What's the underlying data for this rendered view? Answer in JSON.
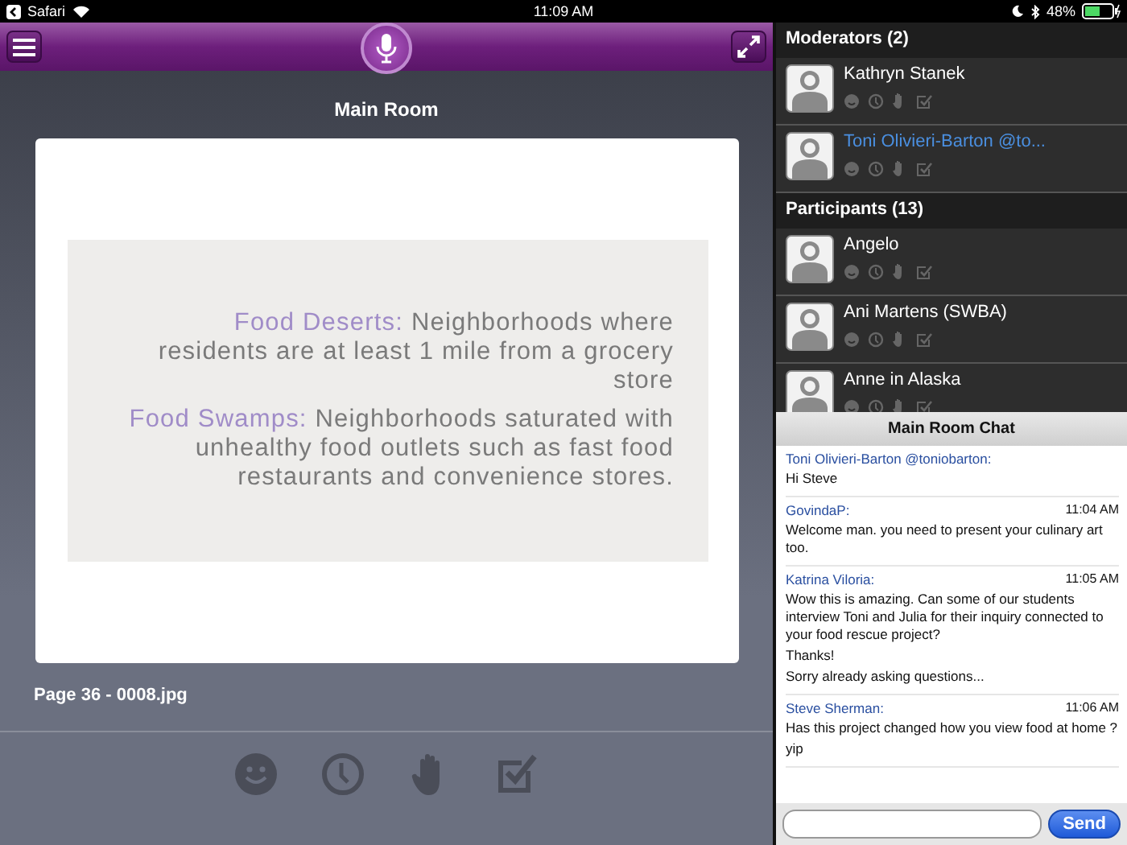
{
  "status_bar": {
    "back_app": "Safari",
    "time": "11:09 AM",
    "battery": "48%"
  },
  "room": {
    "title": "Main Room",
    "page_label": "Page 36 - 0008.jpg"
  },
  "slide": {
    "paragraphs": [
      {
        "term": "Food Deserts:",
        "text": "Neighborhoods where residents are at least 1 mile from a grocery store"
      },
      {
        "term": "Food Swamps:",
        "text": "Neighborhoods saturated with unhealthy food outlets such as fast food restaurants and convenience stores."
      }
    ]
  },
  "groups": [
    {
      "title": "Moderators (2)",
      "members": [
        {
          "name": "Kathryn Stanek",
          "color": "#ffffff"
        },
        {
          "name": "Toni Olivieri-Barton @to...",
          "color": "#4a8fe0"
        }
      ]
    },
    {
      "title": "Participants (13)",
      "members": [
        {
          "name": "Angelo",
          "color": "#ffffff"
        },
        {
          "name": "Ani Martens (SWBA)",
          "color": "#ffffff"
        },
        {
          "name": "Anne in Alaska",
          "color": "#ffffff"
        }
      ]
    }
  ],
  "chat": {
    "title": "Main Room Chat",
    "messages": [
      {
        "sender": "Toni Olivieri-Barton @toniobarton:",
        "lines": [
          "Hi Steve"
        ]
      },
      {
        "sender": "GovindaP:",
        "time": "11:04 AM",
        "lines": [
          "Welcome man. you need to present your culinary art too."
        ]
      },
      {
        "sender": "Katrina Viloria:",
        "time": "11:05 AM",
        "lines": [
          "Wow this is amazing. Can some of our students interview Toni and Julia for their inquiry connected to your food rescue project?",
          "Thanks!",
          "Sorry already asking questions..."
        ]
      },
      {
        "sender": "Steve Sherman:",
        "time": "11:06 AM",
        "lines": [
          "Has this project changed how you view food at home ?",
          "yip"
        ]
      }
    ],
    "send": "Send"
  }
}
